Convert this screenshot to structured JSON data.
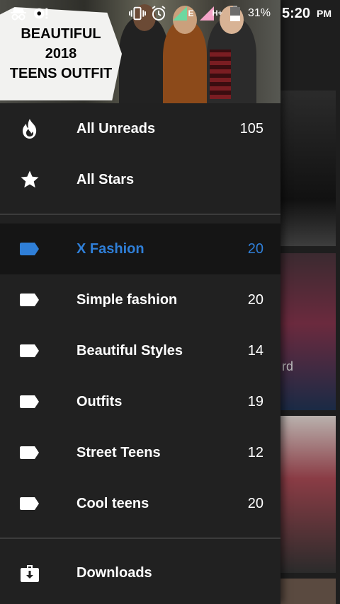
{
  "status_bar": {
    "battery_percent": "31%",
    "time": "5:20",
    "ampm": "PM",
    "network_label": "E",
    "network_label_2": "H+"
  },
  "header": {
    "badge_lines": [
      "BEAUTIFUL",
      "2018",
      "TEENS OUTFIT"
    ]
  },
  "menu": {
    "top_items": [
      {
        "label": "All Unreads",
        "count": "105",
        "icon": "fire-icon"
      },
      {
        "label": "All Stars",
        "count": "",
        "icon": "star-icon"
      }
    ],
    "labels": [
      {
        "label": "X Fashion",
        "count": "20",
        "icon": "label-icon",
        "selected": true
      },
      {
        "label": "Simple fashion",
        "count": "20",
        "icon": "label-icon"
      },
      {
        "label": "Beautiful Styles",
        "count": "14",
        "icon": "label-icon"
      },
      {
        "label": "Outfits",
        "count": "19",
        "icon": "label-icon"
      },
      {
        "label": "Street Teens",
        "count": "12",
        "icon": "label-icon"
      },
      {
        "label": "Cool teens",
        "count": "20",
        "icon": "label-icon"
      }
    ],
    "bottom_items": [
      {
        "label": "Downloads",
        "icon": "downloads-icon"
      }
    ]
  },
  "background": {
    "partial_text": "rd"
  },
  "colors": {
    "drawer_bg": "#212121",
    "accent": "#2f7fd8",
    "selected_bg": "#151515"
  }
}
